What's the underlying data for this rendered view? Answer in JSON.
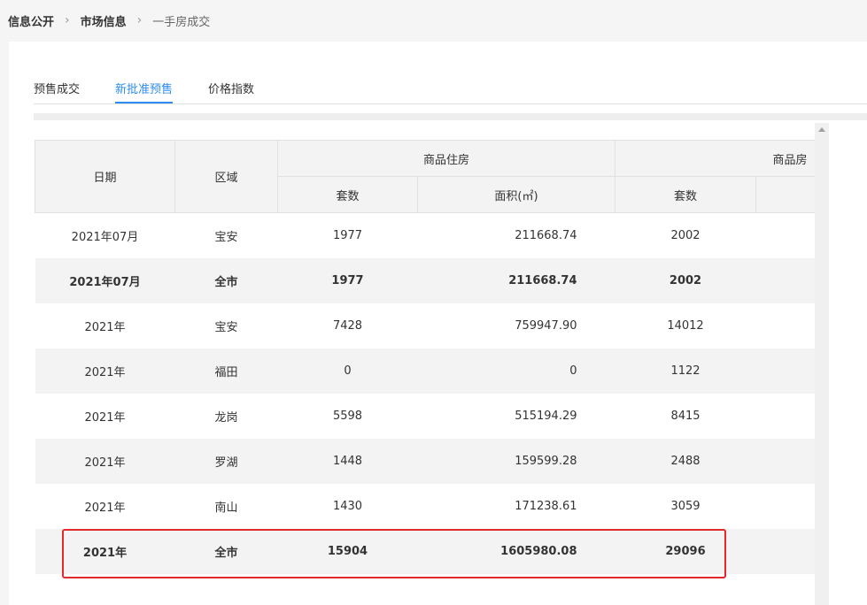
{
  "breadcrumb": {
    "items": [
      "信息公开",
      "市场信息"
    ],
    "current": "一手房成交",
    "separator": "›"
  },
  "tabs": [
    {
      "label": "预售成交",
      "active": false
    },
    {
      "label": "新批准预售",
      "active": true
    },
    {
      "label": "价格指数",
      "active": false
    }
  ],
  "table": {
    "headers": {
      "date": "日期",
      "district": "区域",
      "group1": "商品住房",
      "group2": "商品房",
      "units": "套数",
      "area": "面积(㎡)",
      "units2": "套数"
    },
    "rows": [
      {
        "date": "2021年07月",
        "district": "宝安",
        "units": "1977",
        "area": "211668.74",
        "units2": "2002"
      },
      {
        "date": "2021年07月",
        "district": "全市",
        "units": "1977",
        "area": "211668.74",
        "units2": "2002"
      },
      {
        "date": "2021年",
        "district": "宝安",
        "units": "7428",
        "area": "759947.90",
        "units2": "14012"
      },
      {
        "date": "2021年",
        "district": "福田",
        "units": "0",
        "area": "0",
        "units2": "1122"
      },
      {
        "date": "2021年",
        "district": "龙岗",
        "units": "5598",
        "area": "515194.29",
        "units2": "8415"
      },
      {
        "date": "2021年",
        "district": "罗湖",
        "units": "1448",
        "area": "159599.28",
        "units2": "2488"
      },
      {
        "date": "2021年",
        "district": "南山",
        "units": "1430",
        "area": "171238.61",
        "units2": "3059"
      },
      {
        "date": "2021年",
        "district": "全市",
        "units": "15904",
        "area": "1605980.08",
        "units2": "29096"
      }
    ]
  },
  "colors": {
    "accent": "#2d8cf0",
    "highlight": "#e22a2a",
    "header_bg": "#f3f3f3"
  }
}
